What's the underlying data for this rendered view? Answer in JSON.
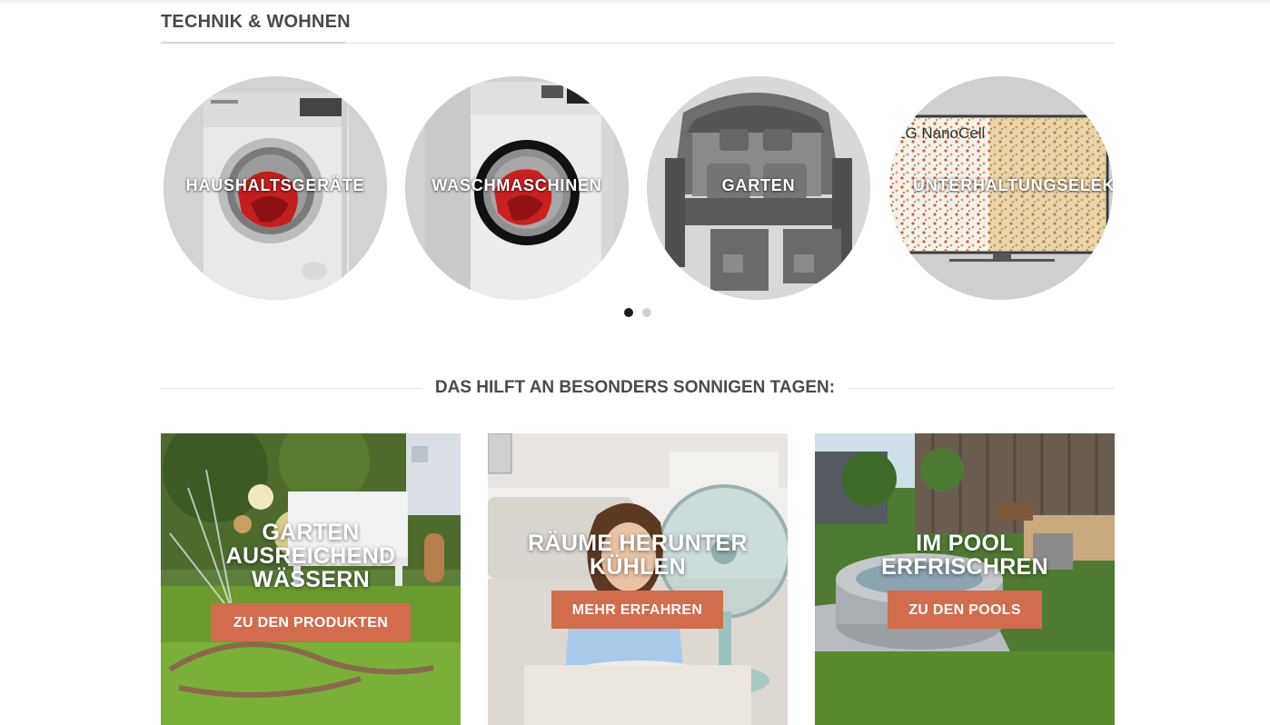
{
  "section": {
    "title": "TECHNIK & WOHNEN"
  },
  "categories": [
    {
      "label": "HAUSHALTSGERÄTE",
      "image": "washing-machine-white"
    },
    {
      "label": "WASCHMASCHINEN",
      "image": "washing-machine-front"
    },
    {
      "label": "GARTEN",
      "image": "beach-chair"
    },
    {
      "label": "UNTERHALTUNGSELEKT",
      "image": "tv-nanocell",
      "tv_brand": "LG NanoCell"
    }
  ],
  "carousel": {
    "pages": 2,
    "active_page": 1
  },
  "promo_heading": "DAS HILFT AN BESONDERS SONNIGEN TAGEN:",
  "promos": [
    {
      "title_lines": [
        "GARTEN",
        "AUSREICHEND",
        "WÄSSERN"
      ],
      "button": "ZU DEN PRODUKTEN",
      "image": "garden-sprinkler"
    },
    {
      "title_lines": [
        "RÄUME HERUNTER",
        "KÜHLEN"
      ],
      "button": "MEHR ERFAHREN",
      "image": "girl-with-fan"
    },
    {
      "title_lines": [
        "IM POOL",
        "ERFRISCHREN"
      ],
      "button": "ZU DEN POOLS",
      "image": "inflatable-pool"
    }
  ],
  "colors": {
    "button": "#d26c4d",
    "heading": "#4a4a4a",
    "dot_active": "#1e1e1e",
    "dot_inactive": "#cfcfcf"
  }
}
